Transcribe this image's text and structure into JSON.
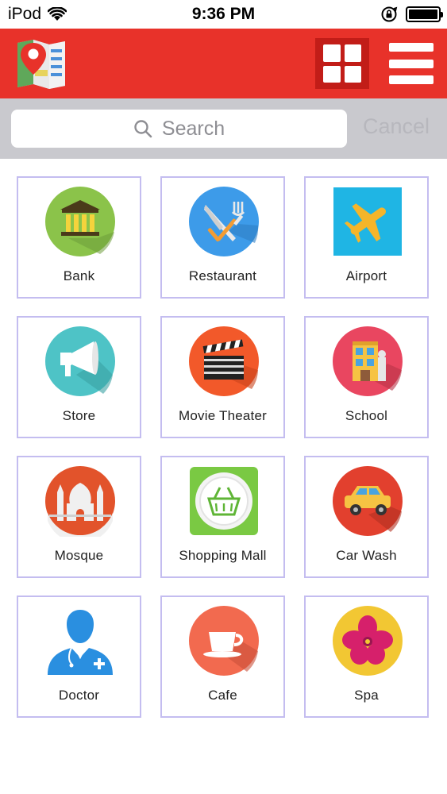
{
  "status_bar": {
    "carrier": "iPod",
    "time": "9:36 PM",
    "wifi_icon": "wifi-icon",
    "rotation_lock_icon": "rotation-lock-icon",
    "battery_icon": "battery-icon"
  },
  "app_bar": {
    "logo_icon": "map-pin-logo-icon",
    "grid_view_icon": "grid-view-icon",
    "menu_icon": "hamburger-menu-icon",
    "color": "#e8322a"
  },
  "search": {
    "placeholder": "Search",
    "cancel_label": "Cancel"
  },
  "categories": [
    {
      "label": "Bank",
      "icon": "bank-icon"
    },
    {
      "label": "Restaurant",
      "icon": "restaurant-icon"
    },
    {
      "label": "Airport",
      "icon": "airport-icon"
    },
    {
      "label": "Store",
      "icon": "store-icon"
    },
    {
      "label": "Movie Theater",
      "icon": "movie-theater-icon"
    },
    {
      "label": "School",
      "icon": "school-icon"
    },
    {
      "label": "Mosque",
      "icon": "mosque-icon"
    },
    {
      "label": "Shopping Mall",
      "icon": "shopping-mall-icon"
    },
    {
      "label": "Car Wash",
      "icon": "car-wash-icon"
    },
    {
      "label": "Doctor",
      "icon": "doctor-icon"
    },
    {
      "label": "Cafe",
      "icon": "cafe-icon"
    },
    {
      "label": "Spa",
      "icon": "spa-icon"
    }
  ]
}
